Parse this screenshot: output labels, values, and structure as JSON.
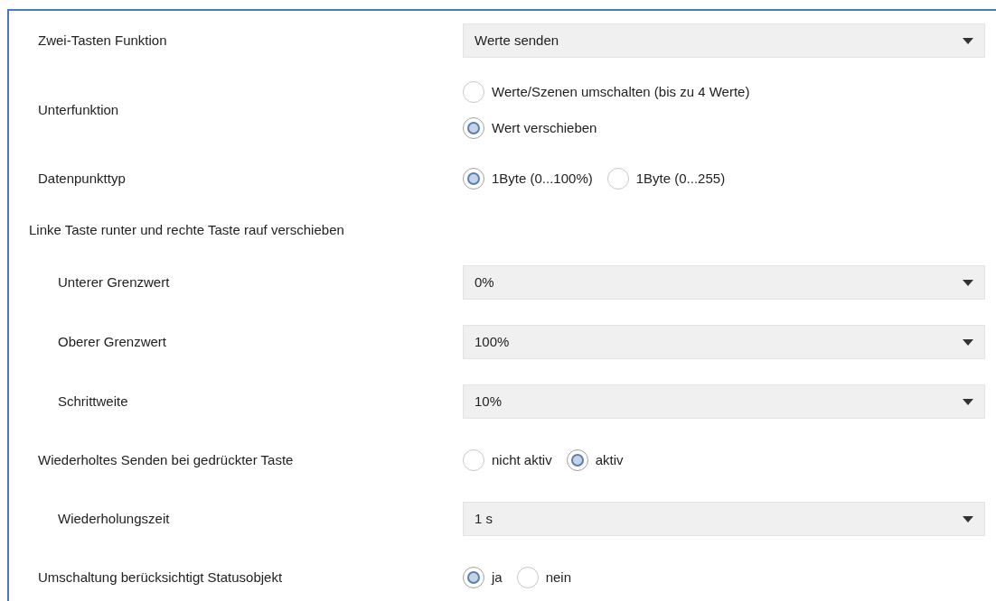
{
  "parameters": [
    {
      "kind": "dropdown",
      "label": "Zwei-Tasten Funktion",
      "value": "Werte senden"
    },
    {
      "kind": "radio-stack",
      "label": "Unterfunktion",
      "options": [
        {
          "label": "Werte/Szenen umschalten (bis zu 4 Werte)",
          "selected": false
        },
        {
          "label": "Wert verschieben",
          "selected": true
        }
      ]
    },
    {
      "kind": "radio",
      "label": "Datenpunkttyp",
      "options": [
        {
          "label": "1Byte (0...100%)",
          "selected": true
        },
        {
          "label": "1Byte (0...255)",
          "selected": false
        }
      ]
    },
    {
      "kind": "heading",
      "label": "Linke Taste runter und rechte Taste rauf verschieben",
      "children": [
        {
          "kind": "dropdown",
          "label": "Unterer Grenzwert",
          "value": "0%"
        },
        {
          "kind": "dropdown",
          "label": "Oberer Grenzwert",
          "value": "100%"
        },
        {
          "kind": "dropdown",
          "label": "Schrittweite",
          "value": "10%"
        }
      ]
    },
    {
      "kind": "radio",
      "label": "Wiederholtes Senden bei gedrückter Taste",
      "options": [
        {
          "label": "nicht aktiv",
          "selected": false
        },
        {
          "label": "aktiv",
          "selected": true
        }
      ],
      "children": [
        {
          "kind": "dropdown",
          "label": "Wiederholungszeit",
          "value": "1 s"
        }
      ]
    },
    {
      "kind": "radio",
      "label": "Umschaltung berücksichtigt Statusobjekt",
      "options": [
        {
          "label": "ja",
          "selected": true
        },
        {
          "label": "nein",
          "selected": false
        }
      ]
    }
  ]
}
